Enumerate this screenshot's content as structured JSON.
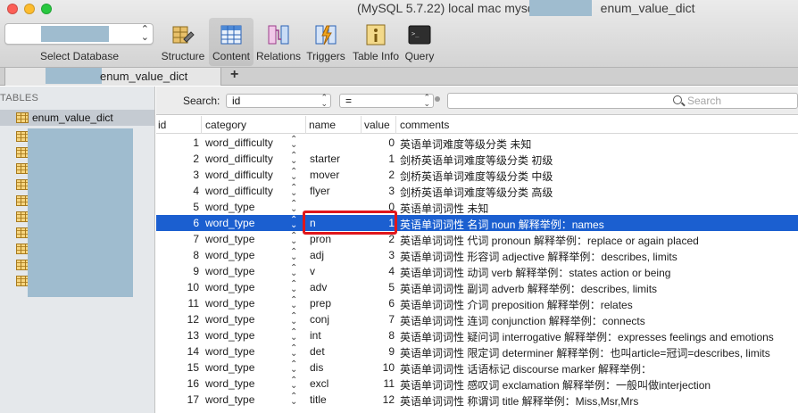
{
  "window": {
    "title": "(MySQL 5.7.22) local mac mysq",
    "title_tail": "enum_value_dict"
  },
  "toolbar": {
    "select_database_label": "Select Database",
    "tools": [
      {
        "label": "Structure",
        "icon": "structure-icon"
      },
      {
        "label": "Content",
        "icon": "content-icon",
        "active": true
      },
      {
        "label": "Relations",
        "icon": "relations-icon"
      },
      {
        "label": "Triggers",
        "icon": "triggers-icon"
      },
      {
        "label": "Table Info",
        "icon": "table-info-icon"
      },
      {
        "label": "Query",
        "icon": "query-icon"
      }
    ]
  },
  "tabs": {
    "active_label": "enum_value_dict",
    "add_label": "+"
  },
  "sidebar": {
    "header": "TABLES",
    "selected_table": "enum_value_dict"
  },
  "filter": {
    "search_label": "Search:",
    "field": "id",
    "operator": "=",
    "placeholder": "Search"
  },
  "grid": {
    "columns": [
      "id",
      "category",
      "name",
      "value",
      "comments"
    ],
    "rows": [
      {
        "id": "1",
        "category": "word_difficulty",
        "name": "",
        "value": "0",
        "comments": "英语单词难度等级分类 未知"
      },
      {
        "id": "2",
        "category": "word_difficulty",
        "name": "starter",
        "value": "1",
        "comments": "剑桥英语单词难度等级分类 初级"
      },
      {
        "id": "3",
        "category": "word_difficulty",
        "name": "mover",
        "value": "2",
        "comments": "剑桥英语单词难度等级分类 中级"
      },
      {
        "id": "4",
        "category": "word_difficulty",
        "name": "flyer",
        "value": "3",
        "comments": "剑桥英语单词难度等级分类 高级"
      },
      {
        "id": "5",
        "category": "word_type",
        "name": "",
        "value": "0",
        "comments": "英语单词词性 未知"
      },
      {
        "id": "6",
        "category": "word_type",
        "name": "n",
        "value": "1",
        "comments": "英语单词词性 名词 noun 解释举例：names"
      },
      {
        "id": "7",
        "category": "word_type",
        "name": "pron",
        "value": "2",
        "comments": "英语单词词性 代词 pronoun 解释举例：replace or again placed"
      },
      {
        "id": "8",
        "category": "word_type",
        "name": "adj",
        "value": "3",
        "comments": "英语单词词性 形容词 adjective 解释举例：describes, limits"
      },
      {
        "id": "9",
        "category": "word_type",
        "name": "v",
        "value": "4",
        "comments": "英语单词词性 动词 verb 解释举例：states action or being"
      },
      {
        "id": "10",
        "category": "word_type",
        "name": "adv",
        "value": "5",
        "comments": "英语单词词性 副词 adverb 解释举例：describes, limits"
      },
      {
        "id": "11",
        "category": "word_type",
        "name": "prep",
        "value": "6",
        "comments": "英语单词词性 介词 preposition 解释举例：relates"
      },
      {
        "id": "12",
        "category": "word_type",
        "name": "conj",
        "value": "7",
        "comments": "英语单词词性 连词 conjunction 解释举例：connects"
      },
      {
        "id": "13",
        "category": "word_type",
        "name": "int",
        "value": "8",
        "comments": "英语单词词性 疑问词 interrogative 解释举例：expresses feelings and emotions"
      },
      {
        "id": "14",
        "category": "word_type",
        "name": "det",
        "value": "9",
        "comments": "英语单词词性 限定词 determiner 解释举例：也叫article=冠词=describes, limits"
      },
      {
        "id": "15",
        "category": "word_type",
        "name": "dis",
        "value": "10",
        "comments": "英语单词词性 话语标记 discourse marker 解释举例："
      },
      {
        "id": "16",
        "category": "word_type",
        "name": "excl",
        "value": "11",
        "comments": "英语单词词性 感叹词 exclamation 解释举例：一般叫做interjection"
      },
      {
        "id": "17",
        "category": "word_type",
        "name": "title",
        "value": "12",
        "comments": "英语单词词性 称谓词 title 解释举例：Miss,Msr,Mrs"
      }
    ],
    "selected_row": 5
  },
  "colors": {
    "selection": "#1b5fd0",
    "highlight_box": "#e0161b",
    "redaction": "#9fbccf"
  }
}
